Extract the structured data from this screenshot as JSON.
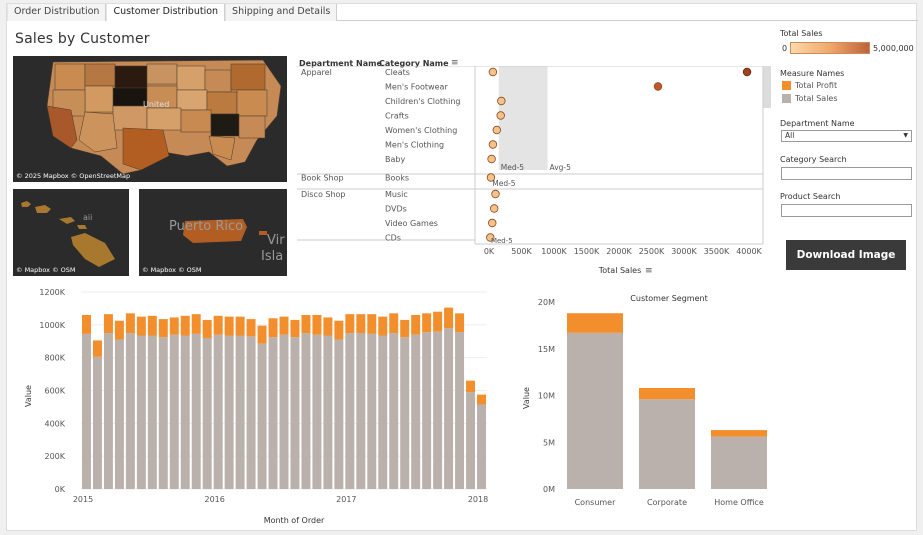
{
  "tabs": [
    "Order Distribution",
    "Customer Distribution",
    "Shipping and Details"
  ],
  "active_tab": 1,
  "title": "Sales by Customer",
  "maps": {
    "main_credit": "© 2025 Mapbox © OpenStreetMap",
    "hawaii_credit": "© Mapbox © OSM",
    "pr_credit": "© Mapbox © OSM",
    "main_label": "United",
    "hawaii_label": "aii",
    "pr_label": "Puerto Rico",
    "pr_label_2": "Vir",
    "pr_label_3": "Isla"
  },
  "dot_plot": {
    "header_dept": "Department Name",
    "header_cat": "Category Name",
    "axis_title": "Total Sales",
    "ref_med": "Med-5",
    "ref_avg": "Avg-5",
    "ref_med_2": "Med-5",
    "ref_med_3": "Med-5",
    "ticks": [
      "0K",
      "500K",
      "1000K",
      "1500K",
      "2000K",
      "2500K",
      "3000K",
      "3500K",
      "4000K"
    ],
    "rows": [
      {
        "dept": "Apparel",
        "cat": "Cleats",
        "value": 60000
      },
      {
        "dept": "",
        "cat": "Men's Footwear",
        "value": 2600000
      },
      {
        "dept": "",
        "cat": "Children's Clothing",
        "value": 190000
      },
      {
        "dept": "",
        "cat": "Crafts",
        "value": 180000
      },
      {
        "dept": "",
        "cat": "Women's Clothing",
        "value": 120000
      },
      {
        "dept": "",
        "cat": "Men's Clothing",
        "value": 60000
      },
      {
        "dept": "",
        "cat": "Baby",
        "value": 40000
      },
      {
        "dept": "Book Shop",
        "cat": "Books",
        "value": 30000
      },
      {
        "dept": "Disco Shop",
        "cat": "Music",
        "value": 100000
      },
      {
        "dept": "",
        "cat": "DVDs",
        "value": 80000
      },
      {
        "dept": "",
        "cat": "Video Games",
        "value": 50000
      },
      {
        "dept": "",
        "cat": "CDs",
        "value": 20000
      }
    ],
    "top_value": 3970000
  },
  "legend": {
    "total_sales_title": "Total Sales",
    "range_min": "0",
    "range_max": "5,000,000",
    "measure_title": "Measure Names",
    "measures": [
      {
        "name": "Total Profit",
        "color": "#f28e2b"
      },
      {
        "name": "Total Sales",
        "color": "#bab0ac"
      }
    ]
  },
  "filters": {
    "dept_label": "Department Name",
    "dept_value": "All",
    "category_label": "Category Search",
    "category_value": "",
    "product_label": "Product Search",
    "product_value": ""
  },
  "download_label": "Download Image",
  "chart_data": [
    {
      "type": "bar",
      "stacked": true,
      "xlabel": "Month of Order",
      "ylabel": "Value",
      "ylim": [
        0,
        1200000
      ],
      "yticks": [
        "0K",
        "200K",
        "400K",
        "600K",
        "800K",
        "1000K",
        "1200K"
      ],
      "xticks": [
        "2015",
        "2016",
        "2017",
        "2018"
      ],
      "categories": [
        "2015-01",
        "2015-02",
        "2015-03",
        "2015-04",
        "2015-05",
        "2015-06",
        "2015-07",
        "2015-08",
        "2015-09",
        "2015-10",
        "2015-11",
        "2015-12",
        "2016-01",
        "2016-02",
        "2016-03",
        "2016-04",
        "2016-05",
        "2016-06",
        "2016-07",
        "2016-08",
        "2016-09",
        "2016-10",
        "2016-11",
        "2016-12",
        "2017-01",
        "2017-02",
        "2017-03",
        "2017-04",
        "2017-05",
        "2017-06",
        "2017-07",
        "2017-08",
        "2017-09",
        "2017-10",
        "2017-11",
        "2017-12",
        "2018-01"
      ],
      "series": [
        {
          "name": "Total Sales",
          "values": [
            945000,
            805000,
            950000,
            910000,
            950000,
            935000,
            935000,
            925000,
            940000,
            935000,
            945000,
            920000,
            940000,
            935000,
            935000,
            930000,
            885000,
            925000,
            940000,
            925000,
            950000,
            940000,
            935000,
            910000,
            950000,
            950000,
            945000,
            935000,
            950000,
            925000,
            940000,
            955000,
            960000,
            980000,
            955000,
            590000,
            515000
          ]
        },
        {
          "name": "Total Profit",
          "values": [
            115000,
            100000,
            115000,
            115000,
            120000,
            115000,
            120000,
            110000,
            105000,
            120000,
            120000,
            110000,
            115000,
            115000,
            115000,
            105000,
            110000,
            115000,
            110000,
            105000,
            110000,
            120000,
            110000,
            115000,
            115000,
            115000,
            120000,
            115000,
            120000,
            105000,
            120000,
            115000,
            120000,
            125000,
            115000,
            70000,
            60000
          ]
        }
      ]
    },
    {
      "type": "bar",
      "stacked": true,
      "title": "Customer Segment",
      "xlabel": "",
      "ylabel": "Value",
      "ylim": [
        0,
        20000000
      ],
      "yticks": [
        "0M",
        "5M",
        "10M",
        "15M",
        "20M"
      ],
      "categories": [
        "Consumer",
        "Corporate",
        "Home Office"
      ],
      "series": [
        {
          "name": "Total Sales",
          "values": [
            16700000,
            9600000,
            5600000
          ]
        },
        {
          "name": "Total Profit",
          "values": [
            2100000,
            1200000,
            700000
          ]
        }
      ]
    }
  ]
}
